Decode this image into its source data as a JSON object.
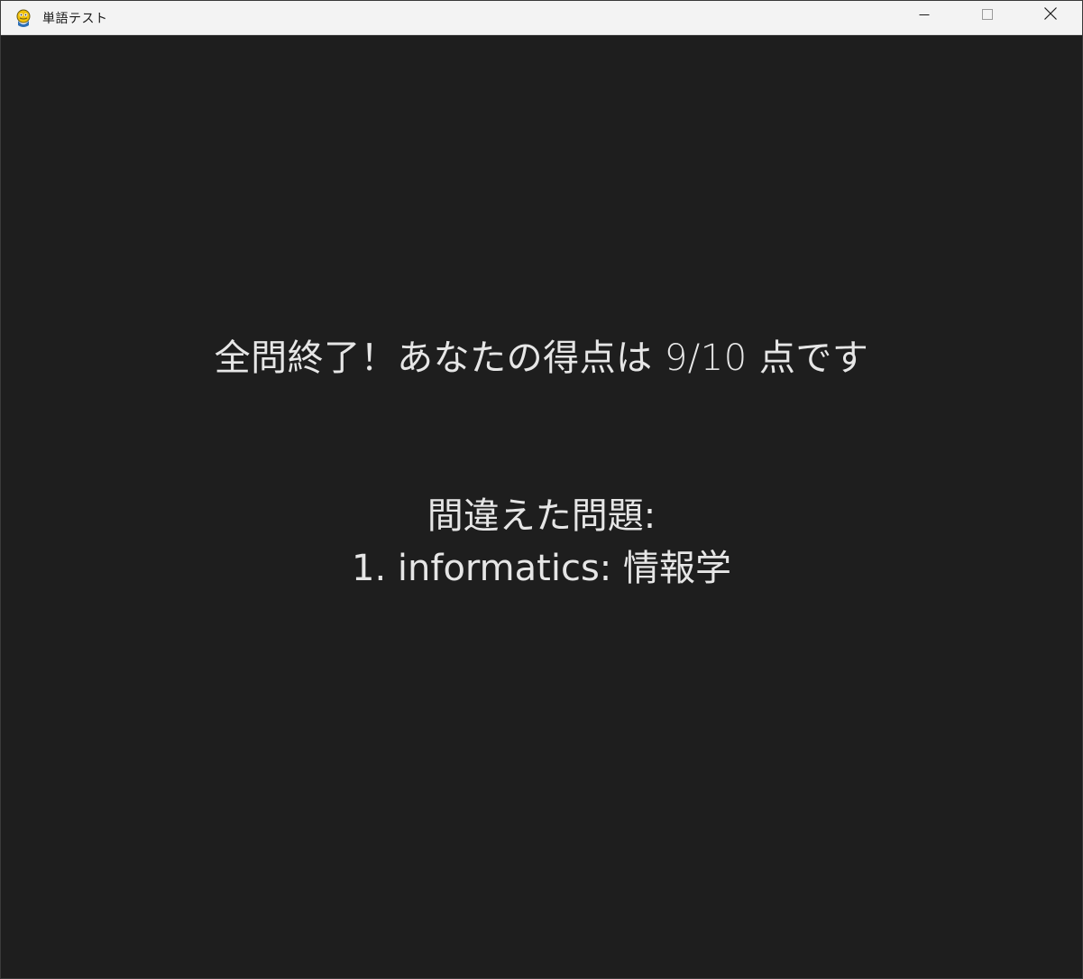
{
  "window": {
    "title": "単語テスト",
    "icon": "pygame-snake-icon"
  },
  "controls": {
    "minimize_icon": "minimize-icon",
    "maximize_icon": "maximize-icon",
    "close_icon": "close-icon"
  },
  "result": {
    "score_message": "全問終了！あなたの得点は 9/10 点です",
    "wrong_heading": "間違えた問題:",
    "wrong_items": [
      "1. informatics: 情報学"
    ]
  },
  "colors": {
    "background": "#1e1e1e",
    "text": "#e6e6e6",
    "titlebar": "#f3f3f3"
  }
}
